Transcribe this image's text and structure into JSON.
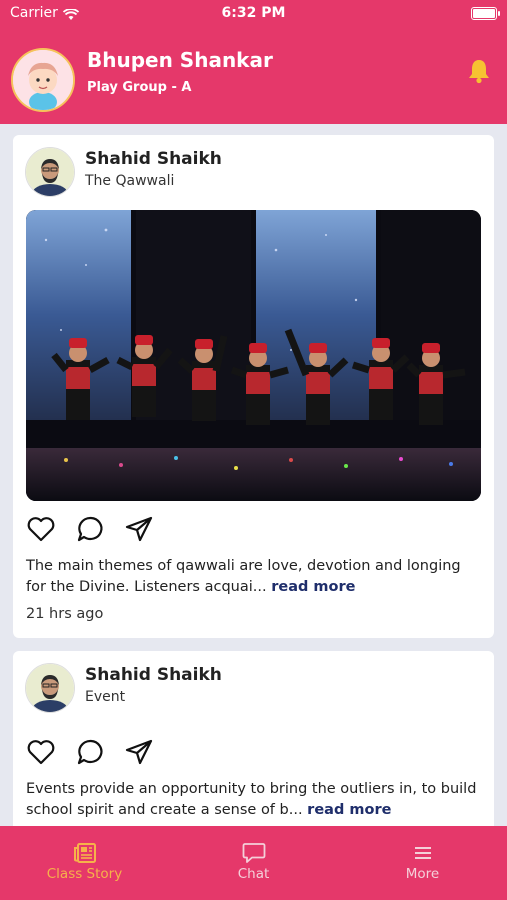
{
  "status_bar": {
    "carrier": "Carrier",
    "time": "6:32 PM"
  },
  "header": {
    "name": "Bhupen Shankar",
    "group": "Play Group - A"
  },
  "posts": [
    {
      "author": "Shahid Shaikh",
      "subtitle": "The Qawwali",
      "caption": "The main themes of qawwali are love, devotion and longing for the Divine. Listeners acquai...",
      "read_more": "read more",
      "time_ago": "21 hrs ago"
    },
    {
      "author": "Shahid Shaikh",
      "subtitle": "Event",
      "caption": "Events provide an opportunity to bring the outliers in, to build school spirit and create a sense of b...",
      "read_more": "read more"
    }
  ],
  "tabs": [
    {
      "label": "Class Story",
      "icon": "newspaper-icon",
      "active": true
    },
    {
      "label": "Chat",
      "icon": "chat-icon",
      "active": false
    },
    {
      "label": "More",
      "icon": "menu-icon",
      "active": false
    }
  ],
  "colors": {
    "brand": "#e5386a",
    "active_tab": "#f6b24a",
    "read_more": "#1f2e6b",
    "bell": "#f6c232"
  }
}
